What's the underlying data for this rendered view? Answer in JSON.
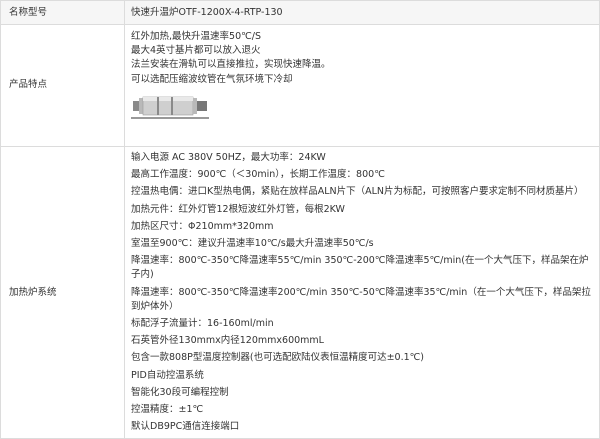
{
  "model": {
    "label": "名称型号",
    "value": "快速升温炉OTF-1200X-4-RTP-130"
  },
  "features": {
    "label": "产品特点",
    "lines": [
      "红外加热,最快升温速率50℃/S",
      "最大4英寸基片都可以放入退火",
      "法兰安装在滑轨可以直接推拉，实现快速降温。",
      "可以选配压缩波纹管在气氛环境下冷却"
    ]
  },
  "heating": {
    "label": "加热炉系统",
    "lines": [
      "输入电源 AC 380V 50HZ，最大功率：24KW",
      "最高工作温度：900℃（＜30min），长期工作温度：800℃",
      "控温热电偶：进口K型热电偶，紧贴在放样品ALN片下（ALN片为标配，可按照客户要求定制不同材质基片）",
      "加热元件：红外灯管12根短波红外灯管，每根2KW",
      "加热区尺寸：Φ210mm*320mm",
      "室温至900℃：建议升温速率10℃/s最大升温速率50℃/s",
      "降温速率：800℃-350℃降温速率55℃/min 350℃-200℃降温速率5℃/min(在一个大气压下，样品架在炉子内)",
      "降温速率：800℃-350℃降温速率200℃/min 350℃-50℃降温速率35℃/min（在一个大气压下，样品架拉到炉体外）",
      "标配浮子流量计：16-160ml/min",
      "石英管外径130mmx内径120mmx600mmL",
      "包含一款808P型温度控制器(也可选配欧陆仪表恒温精度可达±0.1℃)",
      "PID自动控温系统",
      "智能化30段可编程控制",
      "控温精度：±1℃",
      "默认DB9PC通信连接端口"
    ]
  }
}
